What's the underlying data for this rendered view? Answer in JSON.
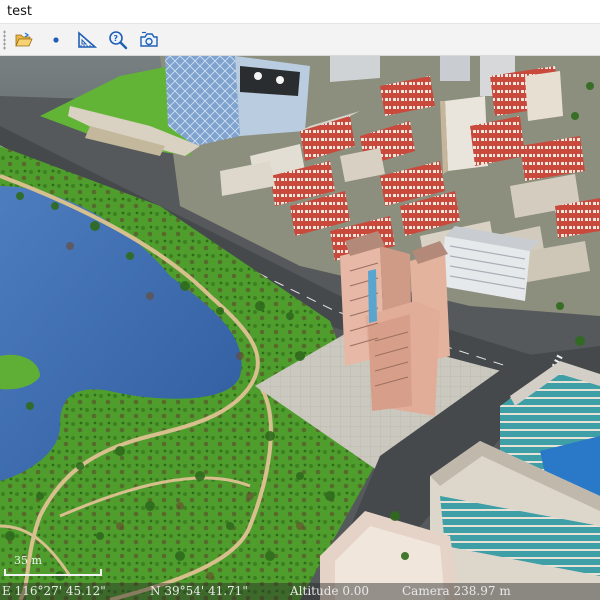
{
  "window": {
    "title": "test"
  },
  "toolbar": {
    "buttons": [
      {
        "name": "open-button",
        "icon": "folder-open-icon"
      },
      {
        "name": "point-button",
        "icon": "dot-icon"
      },
      {
        "name": "measure-button",
        "icon": "triangle-ruler-icon"
      },
      {
        "name": "query-button",
        "icon": "magnifier-question-icon"
      },
      {
        "name": "camera-button",
        "icon": "camera-icon"
      }
    ]
  },
  "scale": {
    "label": "35 m"
  },
  "status": {
    "longitude": "E 116°27' 45.12\"",
    "latitude": "N 39°54' 41.71\"",
    "altitude": "Altitude 0.00",
    "camera": "Camera 238.97 m"
  },
  "colors": {
    "accent": "#1f5fb4",
    "grass": "#4f9e2d",
    "water": "#3a6db5",
    "road": "#4a4f52"
  }
}
